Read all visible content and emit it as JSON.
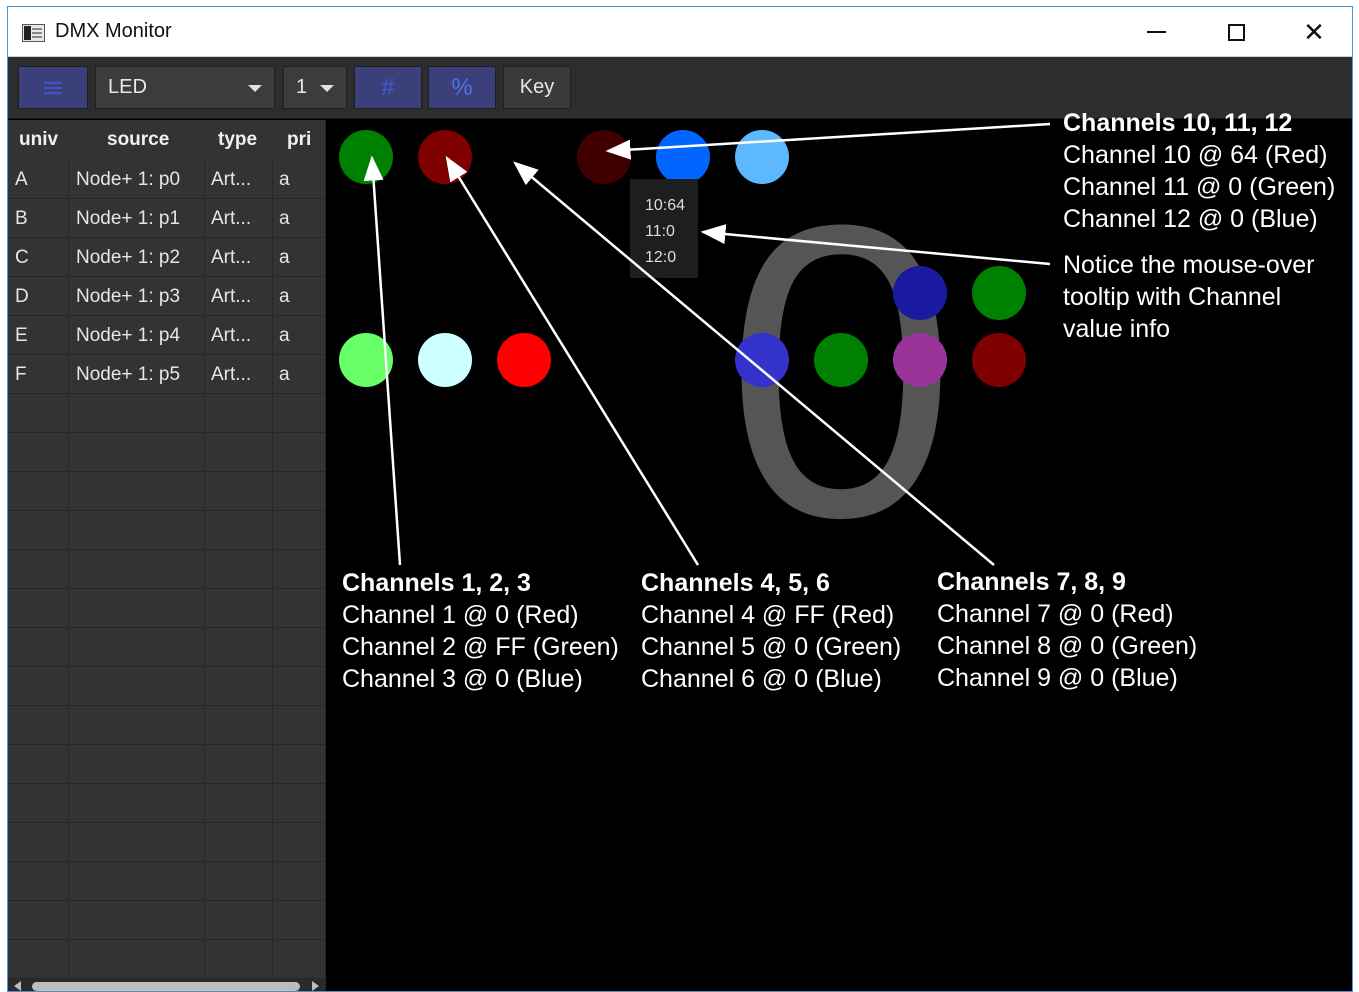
{
  "window": {
    "title": "DMX Monitor"
  },
  "toolbar": {
    "fixture_value": "LED",
    "universe_value": "1",
    "hash_label": "#",
    "percent_label": "%",
    "key_label": "Key"
  },
  "table": {
    "headers": {
      "univ": "univ",
      "source": "source",
      "type": "type",
      "pri": "pri"
    },
    "rows": [
      {
        "univ": "A",
        "source": "Node+ 1: p0",
        "type": "Art...",
        "pri": "a"
      },
      {
        "univ": "B",
        "source": "Node+ 1: p1",
        "type": "Art...",
        "pri": "a"
      },
      {
        "univ": "C",
        "source": "Node+ 1: p2",
        "type": "Art...",
        "pri": "a"
      },
      {
        "univ": "D",
        "source": "Node+ 1: p3",
        "type": "Art...",
        "pri": "a"
      },
      {
        "univ": "E",
        "source": "Node+ 1: p4",
        "type": "Art...",
        "pri": "a"
      },
      {
        "univ": "F",
        "source": "Node+ 1: p5",
        "type": "Art...",
        "pri": "a"
      }
    ]
  },
  "canvas": {
    "big_digit": "0",
    "tooltip": {
      "line1": "10:64",
      "line2": "11:0",
      "line3": "12:0"
    },
    "light_colors": [
      "#008000",
      "#7f0000",
      "#400000",
      "#0066ff",
      "#5cb8ff",
      "#1a1aa0",
      "#008000",
      "#66ff66",
      "#ccffff",
      "#ff0000",
      "#3333cc",
      "#008000",
      "#993399",
      "#7f0000"
    ]
  },
  "annotations": {
    "group_10_12": {
      "heading": "Channels 10, 11, 12",
      "line1": "Channel 10 @ 64 (Red)",
      "line2": "Channel 11 @ 0 (Green)",
      "line3": "Channel 12 @ 0 (Blue)"
    },
    "tooltip_note": {
      "line1": "Notice the mouse-over",
      "line2": "tooltip with Channel",
      "line3": "value info"
    },
    "group_1_3": {
      "heading": "Channels 1, 2, 3",
      "line1": "Channel 1 @ 0 (Red)",
      "line2": "Channel 2 @ FF (Green)",
      "line3": "Channel 3 @ 0 (Blue)"
    },
    "group_4_6": {
      "heading": "Channels 4, 5, 6",
      "line1": "Channel 4 @ FF (Red)",
      "line2": "Channel 5 @ 0 (Green)",
      "line3": "Channel 6 @ 0 (Blue)"
    },
    "group_7_9": {
      "heading": "Channels 7, 8, 9",
      "line1": "Channel 7 @ 0 (Red)",
      "line2": "Channel 8 @ 0 (Green)",
      "line3": "Channel 9 @ 0 (Blue)"
    }
  }
}
